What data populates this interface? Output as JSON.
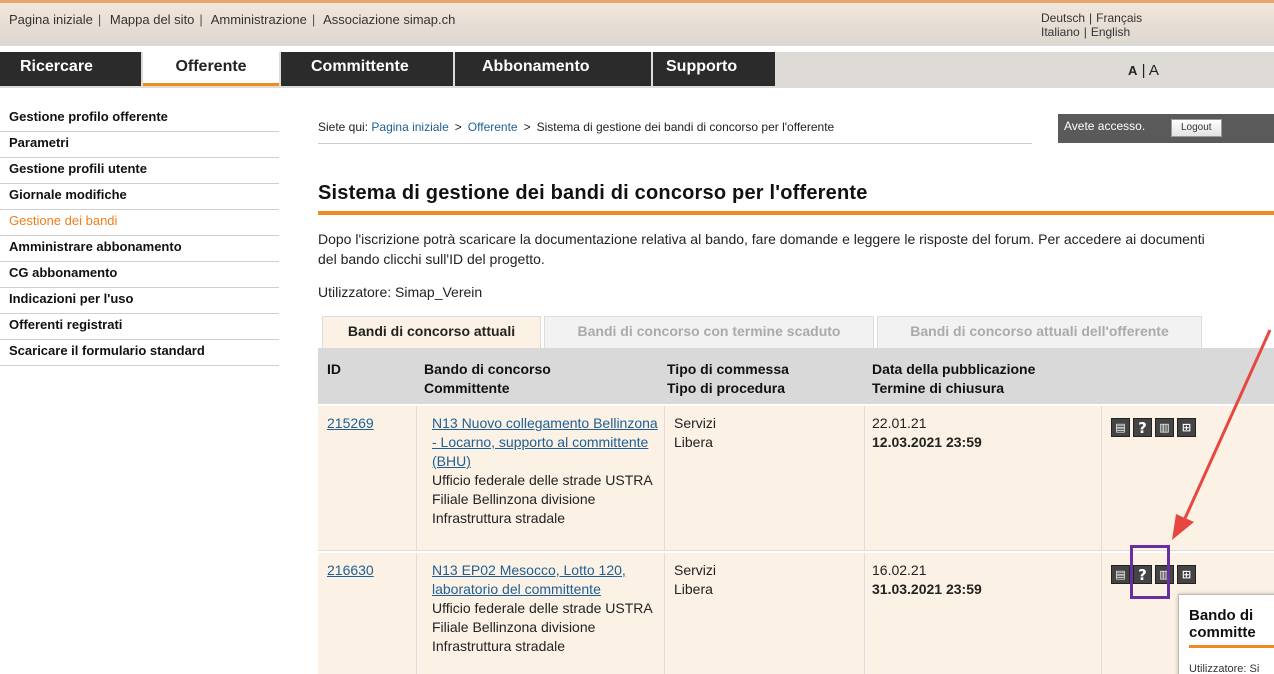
{
  "top_links": {
    "home": "Pagina iniziale",
    "sitemap": "Mappa del sito",
    "admin": "Amministrazione",
    "association": "Associazione simap.ch"
  },
  "languages": {
    "de": "Deutsch",
    "fr": "Français",
    "it": "Italiano",
    "en": "English"
  },
  "mainnav": {
    "search": "Ricercare",
    "bidder": "Offerente",
    "contracting": "Committente",
    "subscription": "Abbonamento",
    "support": "Supporto",
    "font_small": "A",
    "font_sep": "|",
    "font_large": "A"
  },
  "sidebar": {
    "items": [
      "Gestione profilo offerente",
      "Parametri",
      "Gestione profili utente",
      "Giornale modifiche",
      "Gestione dei bandi",
      "Amministrare abbonamento",
      "CG abbonamento",
      "Indicazioni per l'uso",
      "Offerenti registrati",
      "Scaricare il formulario standard"
    ]
  },
  "breadcrumb": {
    "prefix": "Siete qui:",
    "home": "Pagina iniziale",
    "bidder": "Offerente",
    "current": "Sistema di gestione dei bandi di concorso per l'offerente",
    "sep": ">"
  },
  "access": {
    "text": "Avete accesso.",
    "logout": "Logout"
  },
  "page_title": "Sistema di gestione dei bandi di concorso per l'offerente",
  "intro": "Dopo l'iscrizione potrà scaricare la documentazione relativa al bando, fare domande e leggere le risposte del forum. Per accedere ai documenti del bando clicchi sull'ID del progetto.",
  "user_label": "Utilizzatore: Simap_Verein",
  "tabs": [
    "Bandi di concorso attuali",
    "Bandi di concorso con termine scaduto",
    "Bandi di concorso attuali dell'offerente"
  ],
  "table": {
    "headers": {
      "id": "ID",
      "tender": "Bando di concorso",
      "client": "Committente",
      "order_type": "Tipo di commessa",
      "procedure": "Tipo di procedura",
      "pub_date": "Data della pubblicazione",
      "deadline": "Termine di chiusura"
    },
    "rows": [
      {
        "id": "215269",
        "title": "N13 Nuovo collegamento Bellinzona - Locarno, supporto al committente (BHU)",
        "client": "Ufficio federale delle strade USTRA Filiale Bellinzona divisione Infrastruttura stradale",
        "order_type": "Servizi",
        "procedure": "Libera",
        "pub_date": "22.01.21",
        "deadline": "12.03.2021 23:59"
      },
      {
        "id": "216630",
        "title": "N13 EP02 Mesocco, Lotto 120, laboratorio del committente",
        "client": "Ufficio federale delle strade USTRA Filiale Bellinzona divisione Infrastruttura stradale",
        "order_type": "Servizi",
        "procedure": "Libera",
        "pub_date": "16.02.21",
        "deadline": "31.03.2021 23:59"
      }
    ]
  },
  "popup": {
    "title_line1": "Bando di",
    "title_line2": "committe",
    "sub": "Utilizzatore: Si"
  },
  "icons": [
    "book-icon",
    "question-icon",
    "trash-icon",
    "tree-icon"
  ],
  "colors": {
    "accent": "#f08a24",
    "nav_dark": "#2b2b2b",
    "link": "#1f5f95",
    "row_bg": "#fbf2e5",
    "annotation": "#6a2ea0",
    "arrow": "#e8473f"
  }
}
